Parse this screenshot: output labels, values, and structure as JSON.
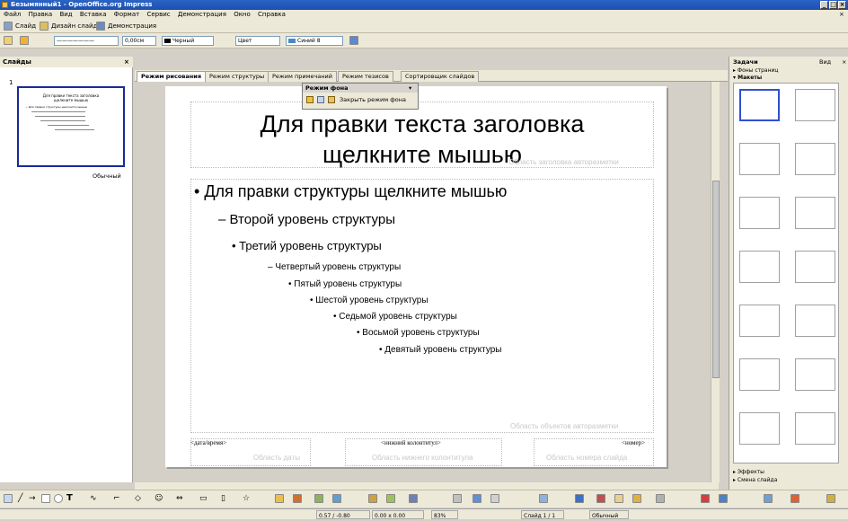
{
  "window": {
    "title": "Безымянный1 - OpenOffice.org Impress",
    "controls": [
      "_",
      "□",
      "×"
    ]
  },
  "menu": [
    "Файл",
    "Правка",
    "Вид",
    "Вставка",
    "Формат",
    "Сервис",
    "Демонстрация",
    "Окно",
    "Справка"
  ],
  "toolbar1": {
    "slide_label": "Слайд",
    "design_label": "Дизайн слайда",
    "presentation_label": "Демонстрация"
  },
  "toolbar2": {
    "line_width": "0,00см",
    "line_color": "Черный",
    "area_style": "Цвет",
    "area_color": "Синий 8"
  },
  "slides_panel": {
    "title": "Слайды",
    "slide_number": "1",
    "slide_layout": "Обычный",
    "thumb_title": "Для правки текста заголовка щелкните мышью",
    "thumb_body": "• Для правки структуры щелкните мышью"
  },
  "tabs": [
    "Режим рисования",
    "Режим структуры",
    "Режим примечаний",
    "Режим тезисов",
    "Сортировщик слайдов"
  ],
  "bg_mode_toolbar": {
    "title": "Режим фона",
    "close_label": "Закрыть режим фона"
  },
  "slide": {
    "title_line1": "Для правки текста заголовка",
    "title_line2": "щелкните мышью",
    "title_area_label": "Область заголовка авторазметки",
    "objects_area_label": "Область объектов авторазметки",
    "outline": [
      "Для правки структуры щелкните мышью",
      "Второй уровень структуры",
      "Третий уровень структуры",
      "Четвертый уровень структуры",
      "Пятый уровень структуры",
      "Шестой уровень структуры",
      "Седьмой уровень структуры",
      "Восьмой уровень структуры",
      "Девятый уровень структуры"
    ],
    "footer_date": "<дата/время>",
    "footer_date_area": "Область даты",
    "footer_text": "<нижний колонтитул>",
    "footer_text_area": "Область нижнего колонтитула",
    "footer_number": "<номер>",
    "footer_number_area": "Область номера слайда"
  },
  "tasks": {
    "title": "Задачи",
    "view_label": "Вид",
    "sections": [
      "Фоны страниц",
      "Макеты",
      "Эффекты",
      "Смена слайда"
    ]
  },
  "status": {
    "position": "0.57 / -0.80",
    "size": "0.00 x 0.00",
    "zoom": "83%",
    "slide": "Слайд 1 / 1",
    "layout": "Обычный"
  }
}
